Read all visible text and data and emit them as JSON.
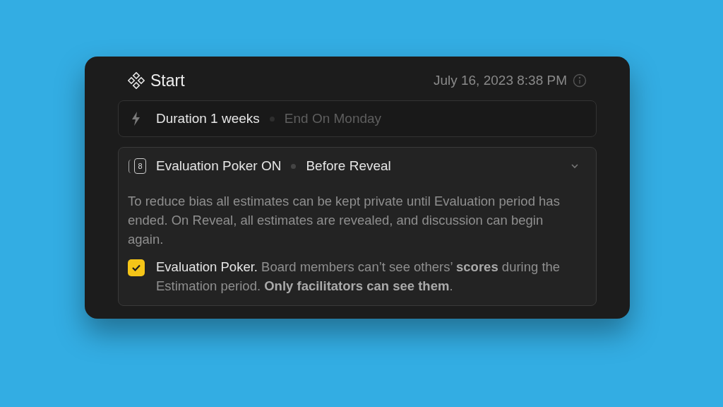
{
  "header": {
    "title": "Start",
    "timestamp": "July 16, 2023 8:38 PM"
  },
  "duration": {
    "label": "Duration 1 weeks",
    "end": "End On Monday"
  },
  "poker": {
    "icon_label": "8",
    "title": "Evaluation Poker ON",
    "status": "Before Reveal",
    "expanded": true,
    "description": "To reduce bias all estimates can be kept private until Evaluation period has ended. On Reveal, all estimates are revealed, and discussion can begin again.",
    "option": {
      "checked": true,
      "lead": "Evaluation Poker.",
      "text": " Board members can’t see others’ **scores** during the Estimation period. **Only facilitators can see them**."
    }
  }
}
